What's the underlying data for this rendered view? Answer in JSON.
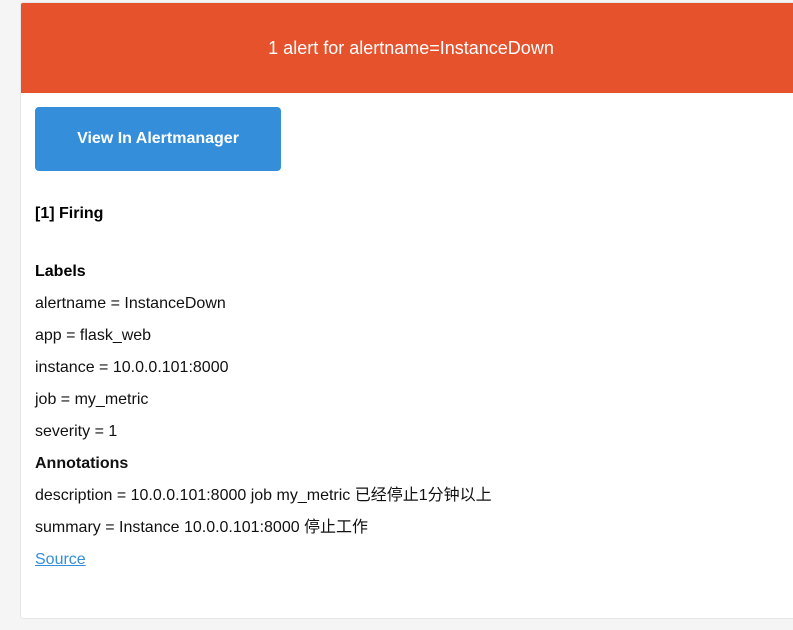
{
  "header": {
    "title": "1 alert for alertname=InstanceDown",
    "color": "#E6522C"
  },
  "actions": {
    "view_button_label": "View In Alertmanager",
    "button_color": "#348EDA"
  },
  "alert": {
    "status": "[1] Firing",
    "labels_title": "Labels",
    "labels": [
      "alertname = InstanceDown",
      "app = flask_web",
      "instance = 10.0.0.101:8000",
      "job = my_metric",
      "severity = 1"
    ],
    "annotations_title": "Annotations",
    "annotations": [
      "description = 10.0.0.101:8000 job my_metric 已经停止1分钟以上",
      "summary = Instance 10.0.0.101:8000 停止工作"
    ],
    "source_link": "Source"
  }
}
